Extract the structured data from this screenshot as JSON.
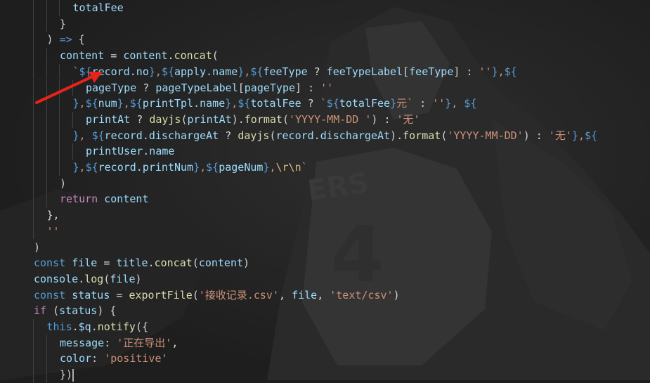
{
  "theme": {
    "background": "#1e1e1e",
    "keyword": "#569cd6",
    "control": "#c586c0",
    "variable": "#9cdcfe",
    "function": "#dcdcaa",
    "string": "#ce9178",
    "punctuation": "#d4d4d4",
    "annotation_arrow": "#e8231b"
  },
  "annotation": {
    "icon": "red-arrow-icon"
  },
  "lines": [
    {
      "indent": 5,
      "tokens": [
        {
          "t": "var",
          "v": "totalFee"
        }
      ]
    },
    {
      "indent": 4,
      "tokens": [
        {
          "t": "pun",
          "v": "}"
        }
      ]
    },
    {
      "indent": 3,
      "tokens": [
        {
          "t": "pun",
          "v": ") "
        },
        {
          "t": "kw",
          "v": "=>"
        },
        {
          "t": "pun",
          "v": " {"
        }
      ]
    },
    {
      "indent": 4,
      "tokens": [
        {
          "t": "var",
          "v": "content"
        },
        {
          "t": "pun",
          "v": " = "
        },
        {
          "t": "var",
          "v": "content"
        },
        {
          "t": "pun",
          "v": "."
        },
        {
          "t": "fn",
          "v": "concat"
        },
        {
          "t": "pun",
          "v": "("
        }
      ]
    },
    {
      "indent": 5,
      "tokens": [
        {
          "t": "str",
          "v": "`"
        },
        {
          "t": "tpl",
          "v": "${"
        },
        {
          "t": "var",
          "v": "record.no"
        },
        {
          "t": "tpl",
          "v": "}"
        },
        {
          "t": "str",
          "v": ","
        },
        {
          "t": "tpl",
          "v": "${"
        },
        {
          "t": "var",
          "v": "apply.name"
        },
        {
          "t": "tpl",
          "v": "}"
        },
        {
          "t": "str",
          "v": ","
        },
        {
          "t": "tpl",
          "v": "${"
        },
        {
          "t": "var",
          "v": "feeType"
        },
        {
          "t": "pun",
          "v": " ? "
        },
        {
          "t": "var",
          "v": "feeTypeLabel"
        },
        {
          "t": "pun",
          "v": "["
        },
        {
          "t": "var",
          "v": "feeType"
        },
        {
          "t": "pun",
          "v": "] : "
        },
        {
          "t": "str",
          "v": "''"
        },
        {
          "t": "tpl",
          "v": "}"
        },
        {
          "t": "str",
          "v": ","
        },
        {
          "t": "tpl",
          "v": "${"
        }
      ]
    },
    {
      "indent": 6,
      "tokens": [
        {
          "t": "var",
          "v": "pageType"
        },
        {
          "t": "pun",
          "v": " ? "
        },
        {
          "t": "var",
          "v": "pageTypeLabel"
        },
        {
          "t": "pun",
          "v": "["
        },
        {
          "t": "var",
          "v": "pageType"
        },
        {
          "t": "pun",
          "v": "] : "
        },
        {
          "t": "str",
          "v": "''"
        }
      ]
    },
    {
      "indent": 5,
      "tokens": [
        {
          "t": "tpl",
          "v": "}"
        },
        {
          "t": "str",
          "v": ","
        },
        {
          "t": "tpl",
          "v": "${"
        },
        {
          "t": "var",
          "v": "num"
        },
        {
          "t": "tpl",
          "v": "}"
        },
        {
          "t": "str",
          "v": ","
        },
        {
          "t": "tpl",
          "v": "${"
        },
        {
          "t": "var",
          "v": "printTpl.name"
        },
        {
          "t": "tpl",
          "v": "}"
        },
        {
          "t": "str",
          "v": ","
        },
        {
          "t": "tpl",
          "v": "${"
        },
        {
          "t": "var",
          "v": "totalFee"
        },
        {
          "t": "pun",
          "v": " ? "
        },
        {
          "t": "str",
          "v": "`"
        },
        {
          "t": "tpl",
          "v": "${"
        },
        {
          "t": "var",
          "v": "totalFee"
        },
        {
          "t": "tpl",
          "v": "}"
        },
        {
          "t": "str",
          "v": "元`"
        },
        {
          "t": "pun",
          "v": " : "
        },
        {
          "t": "str",
          "v": "''"
        },
        {
          "t": "tpl",
          "v": "}"
        },
        {
          "t": "str",
          "v": ", "
        },
        {
          "t": "tpl",
          "v": "${"
        }
      ]
    },
    {
      "indent": 6,
      "tokens": [
        {
          "t": "var",
          "v": "printAt"
        },
        {
          "t": "pun",
          "v": " ? "
        },
        {
          "t": "fn",
          "v": "dayjs"
        },
        {
          "t": "pun",
          "v": "("
        },
        {
          "t": "var",
          "v": "printAt"
        },
        {
          "t": "pun",
          "v": ")."
        },
        {
          "t": "fn",
          "v": "format"
        },
        {
          "t": "pun",
          "v": "("
        },
        {
          "t": "str",
          "v": "'YYYY-MM-DD '"
        },
        {
          "t": "pun",
          "v": ") : "
        },
        {
          "t": "str",
          "v": "'无'"
        }
      ]
    },
    {
      "indent": 5,
      "tokens": [
        {
          "t": "tpl",
          "v": "}"
        },
        {
          "t": "str",
          "v": ", "
        },
        {
          "t": "tpl",
          "v": "${"
        },
        {
          "t": "var",
          "v": "record.dischargeAt"
        },
        {
          "t": "pun",
          "v": " ? "
        },
        {
          "t": "fn",
          "v": "dayjs"
        },
        {
          "t": "pun",
          "v": "("
        },
        {
          "t": "var",
          "v": "record.dischargeAt"
        },
        {
          "t": "pun",
          "v": ")."
        },
        {
          "t": "fn",
          "v": "format"
        },
        {
          "t": "pun",
          "v": "("
        },
        {
          "t": "str",
          "v": "'YYYY-MM-DD'"
        },
        {
          "t": "pun",
          "v": ") : "
        },
        {
          "t": "str",
          "v": "'无'"
        },
        {
          "t": "tpl",
          "v": "}"
        },
        {
          "t": "str",
          "v": ","
        },
        {
          "t": "tpl",
          "v": "${"
        }
      ]
    },
    {
      "indent": 6,
      "tokens": [
        {
          "t": "var",
          "v": "printUser.name"
        }
      ]
    },
    {
      "indent": 5,
      "tokens": [
        {
          "t": "tpl",
          "v": "}"
        },
        {
          "t": "str",
          "v": ","
        },
        {
          "t": "tpl",
          "v": "${"
        },
        {
          "t": "var",
          "v": "record.printNum"
        },
        {
          "t": "tpl",
          "v": "}"
        },
        {
          "t": "str",
          "v": ","
        },
        {
          "t": "tpl",
          "v": "${"
        },
        {
          "t": "var",
          "v": "pageNum"
        },
        {
          "t": "tpl",
          "v": "}"
        },
        {
          "t": "str",
          "v": ","
        },
        {
          "t": "esc",
          "v": "\\r\\n"
        },
        {
          "t": "str",
          "v": "`"
        }
      ]
    },
    {
      "indent": 4,
      "tokens": [
        {
          "t": "pun",
          "v": ")"
        }
      ]
    },
    {
      "indent": 4,
      "tokens": [
        {
          "t": "kw2",
          "v": "return"
        },
        {
          "t": "pun",
          "v": " "
        },
        {
          "t": "var",
          "v": "content"
        }
      ]
    },
    {
      "indent": 3,
      "tokens": [
        {
          "t": "pun",
          "v": "},"
        }
      ]
    },
    {
      "indent": 3,
      "tokens": [
        {
          "t": "str",
          "v": "''"
        }
      ]
    },
    {
      "indent": 2,
      "tokens": [
        {
          "t": "pun",
          "v": ")"
        }
      ]
    },
    {
      "indent": 2,
      "tokens": [
        {
          "t": "kw",
          "v": "const"
        },
        {
          "t": "pun",
          "v": " "
        },
        {
          "t": "var",
          "v": "file"
        },
        {
          "t": "pun",
          "v": " = "
        },
        {
          "t": "var",
          "v": "title"
        },
        {
          "t": "pun",
          "v": "."
        },
        {
          "t": "fn",
          "v": "concat"
        },
        {
          "t": "pun",
          "v": "("
        },
        {
          "t": "var",
          "v": "content"
        },
        {
          "t": "pun",
          "v": ")"
        }
      ]
    },
    {
      "indent": 2,
      "tokens": [
        {
          "t": "var",
          "v": "console"
        },
        {
          "t": "pun",
          "v": "."
        },
        {
          "t": "fn",
          "v": "log"
        },
        {
          "t": "pun",
          "v": "("
        },
        {
          "t": "var",
          "v": "file"
        },
        {
          "t": "pun",
          "v": ")"
        }
      ]
    },
    {
      "indent": 2,
      "tokens": [
        {
          "t": "kw",
          "v": "const"
        },
        {
          "t": "pun",
          "v": " "
        },
        {
          "t": "var",
          "v": "status"
        },
        {
          "t": "pun",
          "v": " = "
        },
        {
          "t": "fn",
          "v": "exportFile"
        },
        {
          "t": "pun",
          "v": "("
        },
        {
          "t": "str",
          "v": "'接收记录.csv'"
        },
        {
          "t": "pun",
          "v": ", "
        },
        {
          "t": "var",
          "v": "file"
        },
        {
          "t": "pun",
          "v": ", "
        },
        {
          "t": "str",
          "v": "'text/csv'"
        },
        {
          "t": "pun",
          "v": ")"
        }
      ]
    },
    {
      "indent": 2,
      "tokens": [
        {
          "t": "kw2",
          "v": "if"
        },
        {
          "t": "pun",
          "v": " ("
        },
        {
          "t": "var",
          "v": "status"
        },
        {
          "t": "pun",
          "v": ") {"
        }
      ]
    },
    {
      "indent": 3,
      "tokens": [
        {
          "t": "kw",
          "v": "this"
        },
        {
          "t": "pun",
          "v": "."
        },
        {
          "t": "var",
          "v": "$q"
        },
        {
          "t": "pun",
          "v": "."
        },
        {
          "t": "fn",
          "v": "notify"
        },
        {
          "t": "pun",
          "v": "("
        },
        {
          "t": "pun",
          "v": "{"
        }
      ]
    },
    {
      "indent": 4,
      "tokens": [
        {
          "t": "prop",
          "v": "message"
        },
        {
          "t": "pun",
          "v": ": "
        },
        {
          "t": "str",
          "v": "'正在导出'"
        },
        {
          "t": "pun",
          "v": ","
        }
      ]
    },
    {
      "indent": 4,
      "tokens": [
        {
          "t": "prop",
          "v": "color"
        },
        {
          "t": "pun",
          "v": ": "
        },
        {
          "t": "str",
          "v": "'positive'"
        }
      ]
    },
    {
      "indent": 4,
      "tokens": [
        {
          "t": "pun",
          "v": "})"
        }
      ]
    }
  ]
}
